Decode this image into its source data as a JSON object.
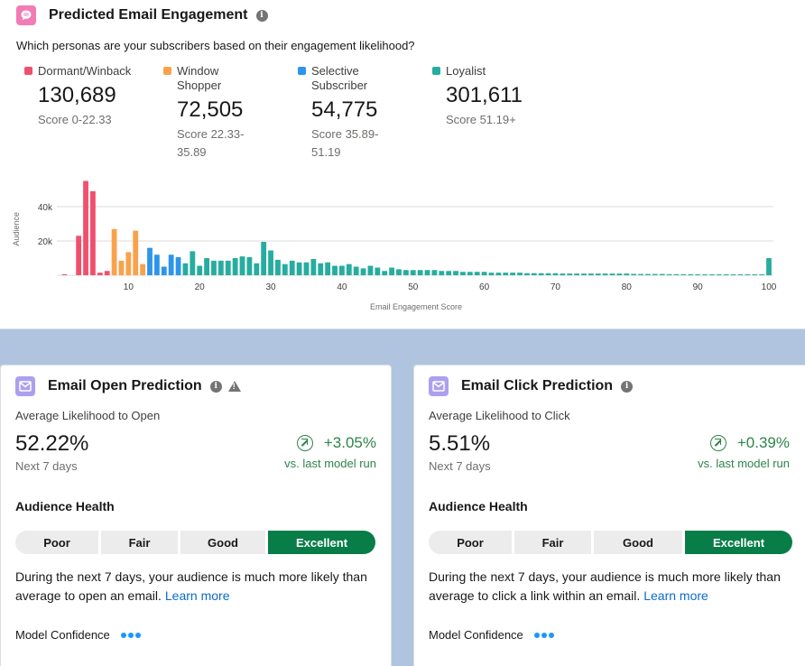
{
  "engagement": {
    "title": "Predicted Email Engagement",
    "subtitle": "Which personas are your subscribers based on their engagement likelihood?",
    "personas": [
      {
        "name": "Dormant/Winback",
        "count": "130,689",
        "range": "Score 0-22.33",
        "color": "#f0506e"
      },
      {
        "name": "Window Shopper",
        "count": "72,505",
        "range": "Score 22.33-35.89",
        "color": "#f9a24b"
      },
      {
        "name": "Selective Subscriber",
        "count": "54,775",
        "range": "Score 35.89-51.19",
        "color": "#2d95ea"
      },
      {
        "name": "Loyalist",
        "count": "301,611",
        "range": "Score 51.19+",
        "color": "#26ad9f"
      }
    ]
  },
  "chart_data": {
    "type": "bar",
    "title": "",
    "xlabel": "Email Engagement Score",
    "ylabel": "Audience",
    "xlim": [
      0,
      100
    ],
    "ylim": [
      0,
      58000
    ],
    "x_ticks": [
      10,
      20,
      30,
      40,
      50,
      60,
      70,
      80,
      90,
      100
    ],
    "y_ticks": [
      {
        "value": 20000,
        "label": "20k"
      },
      {
        "value": 40000,
        "label": "40k"
      }
    ],
    "grid": true,
    "series": [
      {
        "name": "Dormant/Winback",
        "color": "#f0506e",
        "x": [
          1,
          2,
          3,
          4,
          5,
          6,
          7
        ],
        "values": [
          500,
          0,
          23000,
          55000,
          49000,
          1500,
          2500
        ]
      },
      {
        "name": "Window Shopper",
        "color": "#f9a24b",
        "x": [
          8,
          9,
          10,
          11,
          12
        ],
        "values": [
          27000,
          8500,
          13500,
          26000,
          6500
        ]
      },
      {
        "name": "Selective Subscriber",
        "color": "#2d95ea",
        "x": [
          13,
          14,
          15,
          16,
          17
        ],
        "values": [
          16000,
          12000,
          5000,
          12000,
          10500
        ]
      },
      {
        "name": "Loyalist",
        "color": "#26ad9f",
        "x": [
          18,
          19,
          20,
          21,
          22,
          23,
          24,
          25,
          26,
          27,
          28,
          29,
          30,
          31,
          32,
          33,
          34,
          35,
          36,
          37,
          38,
          39,
          40,
          41,
          42,
          43,
          44,
          45,
          46,
          47,
          48,
          49,
          50,
          51,
          52,
          53,
          54,
          55,
          56,
          57,
          58,
          59,
          60,
          61,
          62,
          63,
          64,
          65,
          66,
          67,
          68,
          69,
          70,
          71,
          72,
          73,
          74,
          75,
          76,
          77,
          78,
          79,
          80,
          81,
          82,
          83,
          84,
          85,
          86,
          87,
          88,
          89,
          90,
          91,
          92,
          93,
          94,
          95,
          96,
          97,
          98,
          99,
          100
        ],
        "values": [
          7000,
          14000,
          5500,
          10000,
          8500,
          8500,
          8500,
          10000,
          11000,
          10500,
          7000,
          19500,
          14500,
          9000,
          6500,
          8500,
          7500,
          7500,
          9500,
          7000,
          7500,
          5500,
          5500,
          6500,
          5000,
          4000,
          5500,
          4500,
          2500,
          4500,
          3500,
          3000,
          3000,
          3000,
          3000,
          3000,
          2500,
          2500,
          2500,
          2000,
          2000,
          2000,
          2000,
          1500,
          1500,
          1500,
          1500,
          1500,
          1200,
          1200,
          1200,
          1200,
          1200,
          1000,
          1000,
          1000,
          1000,
          1000,
          1000,
          1000,
          1000,
          1000,
          1000,
          800,
          700,
          700,
          700,
          700,
          600,
          600,
          600,
          600,
          500,
          500,
          500,
          500,
          500,
          500,
          500,
          500,
          500,
          500,
          10000
        ]
      }
    ]
  },
  "open_card": {
    "title": "Email Open Prediction",
    "metric_label": "Average Likelihood to Open",
    "metric_value": "52.22%",
    "metric_sub": "Next 7 days",
    "delta": "+3.05%",
    "delta_sub": "vs. last model run",
    "health_title": "Audience Health",
    "health_levels": [
      "Poor",
      "Fair",
      "Good",
      "Excellent"
    ],
    "health_selected": "Excellent",
    "description": "During the next 7 days, your audience is much more likely than average to open an email.",
    "learn_more": "Learn more",
    "confidence_label": "Model Confidence",
    "confidence_level": "3 of 3"
  },
  "click_card": {
    "title": "Email Click Prediction",
    "metric_label": "Average Likelihood to Click",
    "metric_value": "5.51%",
    "metric_sub": "Next 7 days",
    "delta": "+0.39%",
    "delta_sub": "vs. last model run",
    "health_title": "Audience Health",
    "health_levels": [
      "Poor",
      "Fair",
      "Good",
      "Excellent"
    ],
    "health_selected": "Excellent",
    "description": "During the next 7 days, your audience is much more likely than average to click a link within an email.",
    "learn_more": "Learn more",
    "confidence_label": "Model Confidence",
    "confidence_level": "3 of 3"
  }
}
